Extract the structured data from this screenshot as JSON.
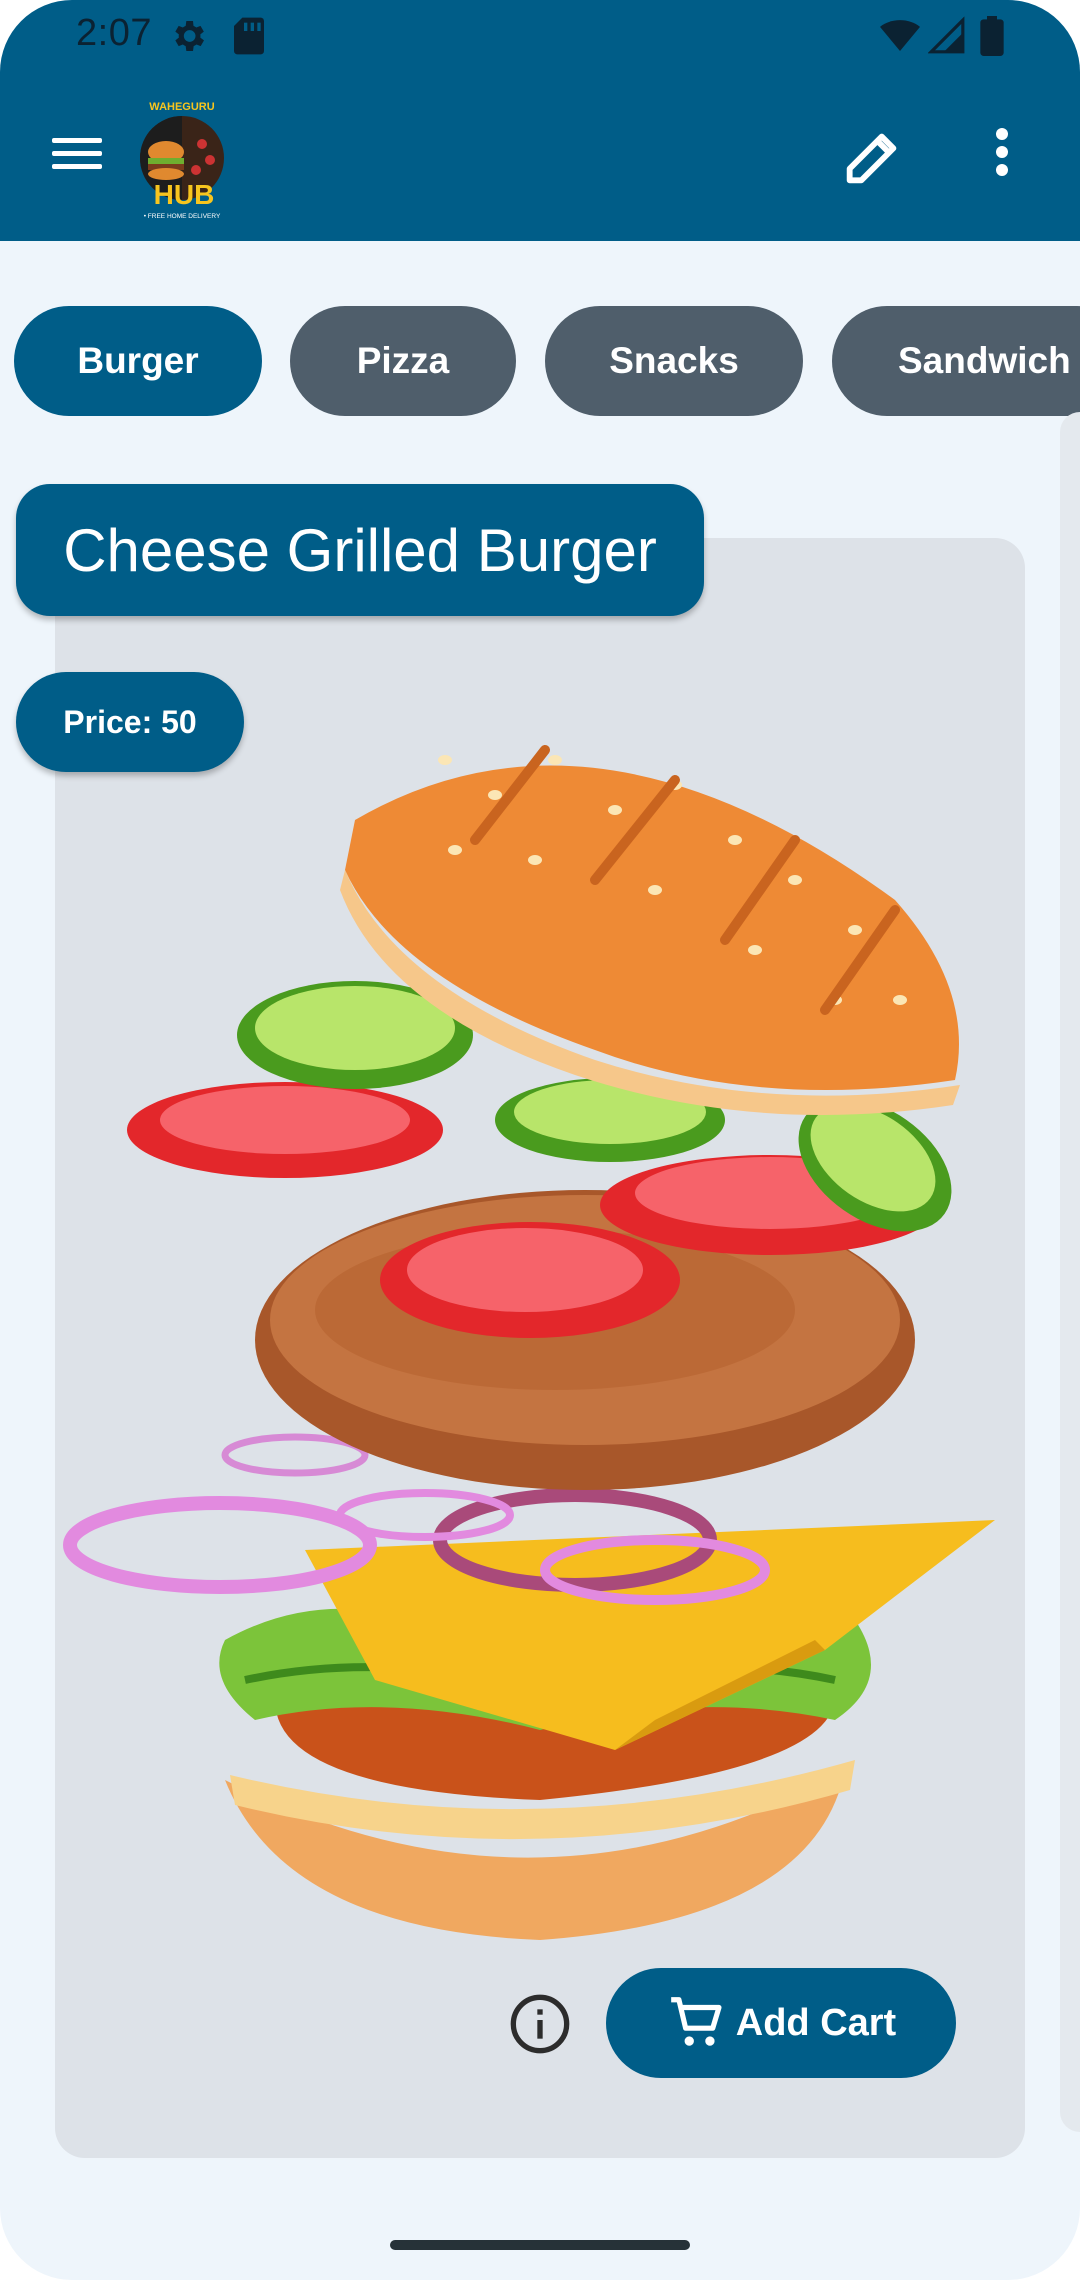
{
  "status_bar": {
    "time": "2:07",
    "icons": [
      "settings-gear-icon",
      "sd-card-icon",
      "wifi-icon",
      "cellular-signal-icon",
      "battery-icon"
    ]
  },
  "app_bar": {
    "logo_text": "WAHEGURU HUB",
    "logo_tagline": "FREE HOME DELIVERY",
    "actions": [
      "edit-icon",
      "more-vert-icon"
    ]
  },
  "categories": [
    {
      "label": "Burger",
      "active": true
    },
    {
      "label": "Pizza",
      "active": false
    },
    {
      "label": "Snacks",
      "active": false
    },
    {
      "label": "Sandwich",
      "active": false
    }
  ],
  "item": {
    "title": "Cheese Grilled Burger",
    "price_label": "Price: 50",
    "add_cart_label": "Add Cart"
  },
  "colors": {
    "primary": "#005d88",
    "chip_inactive": "#4f5e6b",
    "background": "#eef5fb",
    "card": "#dde2e8"
  }
}
